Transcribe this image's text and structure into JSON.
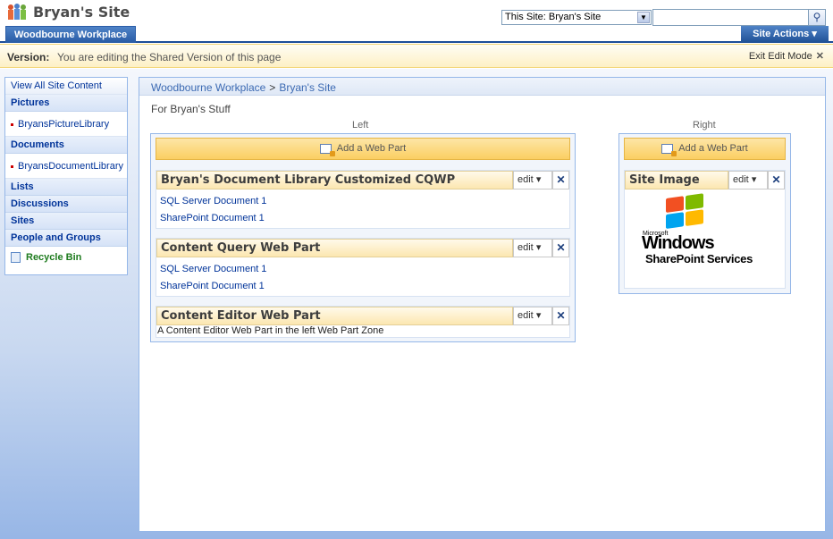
{
  "header": {
    "site_title": "Bryan's Site",
    "search_scope": "This Site: Bryan's Site",
    "search_input_value": ""
  },
  "tabs": {
    "active": "Woodbourne Workplace",
    "site_actions": "Site Actions"
  },
  "edit_bar": {
    "label": "Version:",
    "text": "You are editing the Shared Version of this page",
    "exit": "Exit Edit Mode"
  },
  "quick_launch": {
    "view_all": "View All Site Content",
    "pictures": "Pictures",
    "pictures_item": "BryansPictureLibrary",
    "documents": "Documents",
    "documents_item": "BryansDocumentLibrary",
    "lists": "Lists",
    "discussions": "Discussions",
    "sites": "Sites",
    "people": "People and Groups",
    "recycle": "Recycle Bin"
  },
  "main": {
    "breadcrumb_root": "Woodbourne Workplace",
    "breadcrumb_sep": ">",
    "breadcrumb_current": "Bryan's Site",
    "description": "For Bryan's Stuff"
  },
  "zones": {
    "left_label": "Left",
    "right_label": "Right",
    "add_web_part": "Add a Web Part"
  },
  "webparts": {
    "edit_label": "edit",
    "wp1_title": "Bryan's Document Library Customized CQWP",
    "wp1_items": [
      "SQL Server Document 1",
      "SharePoint Document 1"
    ],
    "wp2_title": "Content Query Web Part",
    "wp2_items": [
      "SQL Server Document 1",
      "SharePoint Document 1"
    ],
    "wp3_title": "Content Editor Web Part",
    "wp3_text": "A Content Editor Web Part in the left Web Part Zone",
    "wp4_title": "Site Image",
    "logo_microsoft": "Microsoft",
    "logo_windows": "Windows",
    "logo_sps": "SharePoint Services"
  }
}
